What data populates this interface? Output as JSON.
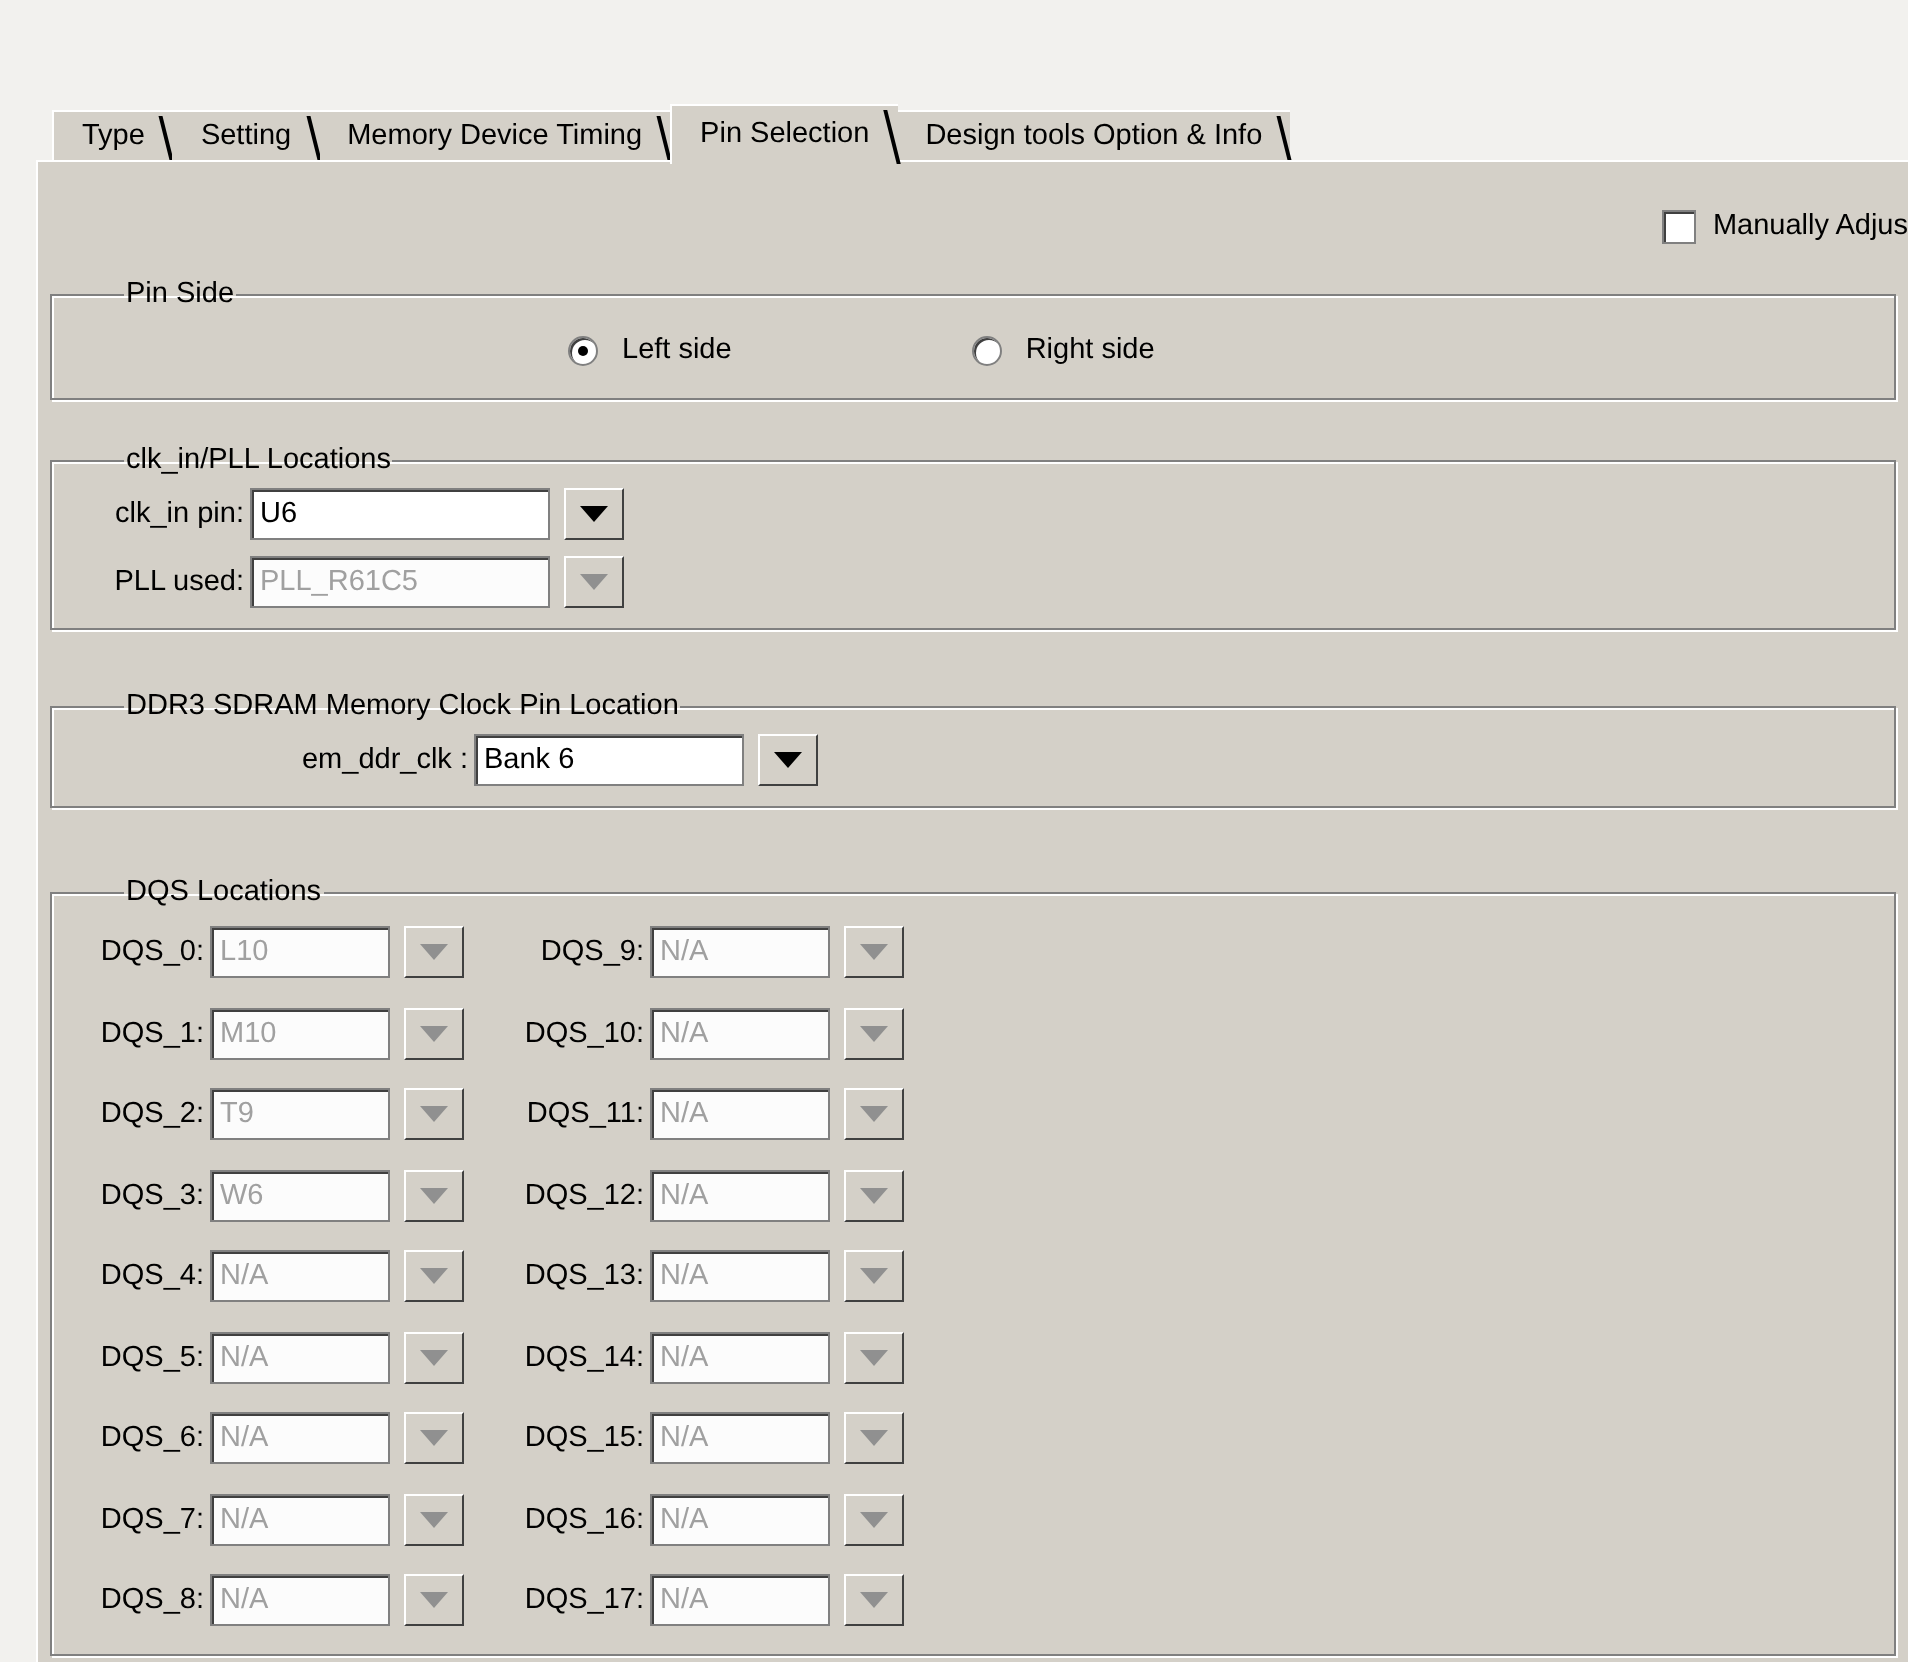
{
  "tabs": [
    {
      "label": "Type",
      "selected": false
    },
    {
      "label": "Setting",
      "selected": false
    },
    {
      "label": "Memory Device Timing",
      "selected": false
    },
    {
      "label": "Pin Selection",
      "selected": true
    },
    {
      "label": "Design tools Option & Info",
      "selected": false
    }
  ],
  "manual_adjust": {
    "label": "Manually Adjus",
    "checked": false
  },
  "pin_side": {
    "title": "Pin Side",
    "options": [
      {
        "label": "Left side",
        "selected": true
      },
      {
        "label": "Right side",
        "selected": false
      }
    ]
  },
  "clk_pll": {
    "title": "clk_in/PLL Locations",
    "fields": [
      {
        "label": "clk_in pin:",
        "value": "U6",
        "disabled": false
      },
      {
        "label": "PLL used:",
        "value": "PLL_R61C5",
        "disabled": true
      }
    ]
  },
  "ddr3_clock": {
    "title": "DDR3 SDRAM Memory Clock Pin Location",
    "fields": [
      {
        "label": "em_ddr_clk :",
        "value": "Bank 6",
        "disabled": false
      }
    ]
  },
  "dqs": {
    "title": "DQS Locations",
    "columns": [
      [
        {
          "label": "DQS_0:",
          "value": "L10",
          "disabled": true
        },
        {
          "label": "DQS_1:",
          "value": "M10",
          "disabled": true
        },
        {
          "label": "DQS_2:",
          "value": "T9",
          "disabled": true
        },
        {
          "label": "DQS_3:",
          "value": "W6",
          "disabled": true
        },
        {
          "label": "DQS_4:",
          "value": "N/A",
          "disabled": true
        },
        {
          "label": "DQS_5:",
          "value": "N/A",
          "disabled": true
        },
        {
          "label": "DQS_6:",
          "value": "N/A",
          "disabled": true
        },
        {
          "label": "DQS_7:",
          "value": "N/A",
          "disabled": true
        },
        {
          "label": "DQS_8:",
          "value": "N/A",
          "disabled": true
        }
      ],
      [
        {
          "label": "DQS_9:",
          "value": "N/A",
          "disabled": true
        },
        {
          "label": "DQS_10:",
          "value": "N/A",
          "disabled": true
        },
        {
          "label": "DQS_11:",
          "value": "N/A",
          "disabled": true
        },
        {
          "label": "DQS_12:",
          "value": "N/A",
          "disabled": true
        },
        {
          "label": "DQS_13:",
          "value": "N/A",
          "disabled": true
        },
        {
          "label": "DQS_14:",
          "value": "N/A",
          "disabled": true
        },
        {
          "label": "DQS_15:",
          "value": "N/A",
          "disabled": true
        },
        {
          "label": "DQS_16:",
          "value": "N/A",
          "disabled": true
        },
        {
          "label": "DQS_17:",
          "value": "N/A",
          "disabled": true
        }
      ]
    ]
  }
}
